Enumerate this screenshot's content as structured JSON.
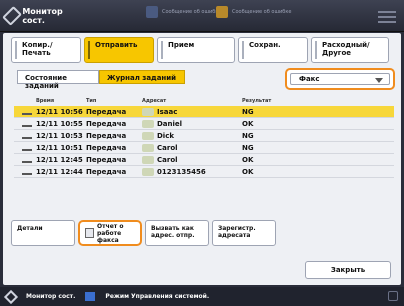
{
  "topbar": {
    "menu_label": "Монитор сост.",
    "status1": "Сообщение об ошибке",
    "status2": "Сообщение об ошибке"
  },
  "tabs": [
    {
      "label": "Копир./ Печать",
      "active": false
    },
    {
      "label": "Отправить",
      "active": true
    },
    {
      "label": "Прием",
      "active": false
    },
    {
      "label": "Сохран.",
      "active": false
    },
    {
      "label": "Расходный/ Другое",
      "active": false
    }
  ],
  "subtabs": [
    {
      "label": "Состояние заданий",
      "active": false
    },
    {
      "label": "Журнал заданий",
      "active": true
    }
  ],
  "filter": {
    "value": "Факс"
  },
  "table": {
    "headers": [
      "Время",
      "Тип",
      "Адресат",
      "Результат"
    ],
    "rows": [
      {
        "time": "12/11 10:56",
        "type": "Передача",
        "dest": "Isaac",
        "result": "NG",
        "selected": true
      },
      {
        "time": "12/11 10:55",
        "type": "Передача",
        "dest": "Daniel",
        "result": "OK",
        "selected": false
      },
      {
        "time": "12/11 10:53",
        "type": "Передача",
        "dest": "Dick",
        "result": "NG",
        "selected": false
      },
      {
        "time": "12/11 10:51",
        "type": "Передача",
        "dest": "Carol",
        "result": "NG",
        "selected": false
      },
      {
        "time": "12/11 12:45",
        "type": "Передача",
        "dest": "Carol",
        "result": "OK",
        "selected": false
      },
      {
        "time": "12/11 12:44",
        "type": "Передача",
        "dest": "0123135456",
        "result": "OK",
        "selected": false
      }
    ]
  },
  "actions": {
    "details": "Детали",
    "report": "Отчет о работе факса",
    "call": "Вызвать как адрес. отпр.",
    "register": "Зарегистр. адресата"
  },
  "close_label": "Закрыть",
  "statusbar": {
    "label1": "Монитор сост.",
    "label2": "Режим Управления системой."
  }
}
